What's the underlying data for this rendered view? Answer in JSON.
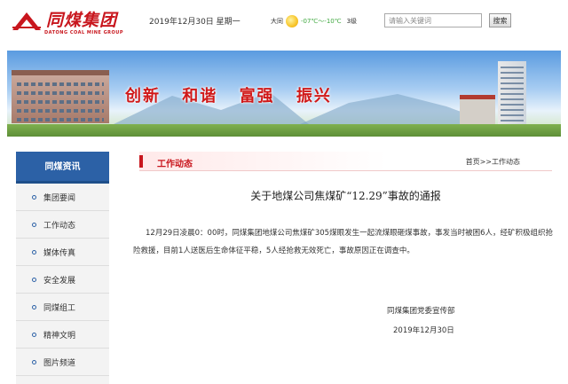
{
  "header": {
    "logo_title": "同煤集团",
    "logo_subtitle": "DATONG COAL MINE GROUP",
    "date": "2019年12月30日  星期一",
    "weather_city": "大同",
    "weather_icon": "sun-icon",
    "weather_temp": "-07℃～-10℃",
    "weather_wind": "3级",
    "search_placeholder": "请输入关键词",
    "search_button": "搜索"
  },
  "banner": {
    "slogan": [
      "创新",
      "和谐",
      "富强",
      "振兴"
    ]
  },
  "sidebar": {
    "title": "同煤资讯",
    "items": [
      {
        "label": "集团要闻"
      },
      {
        "label": "工作动态"
      },
      {
        "label": "媒体传真"
      },
      {
        "label": "安全发展"
      },
      {
        "label": "同煤组工"
      },
      {
        "label": "精神文明"
      },
      {
        "label": "图片频道"
      }
    ]
  },
  "content": {
    "section_title": "工作动态",
    "breadcrumb": "首页>>工作动态",
    "article_title": "关于地煤公司焦煤矿“12.29”事故的通报",
    "article_body": "12月29日凌晨0：00时，同煤集团地煤公司焦煤矿305煤眼发生一起流煤眼砸煤事故，事发当时被困6人，经矿积极组织抢险救援，目前1人送医后生命体征平稳，5人经抢救无效死亡，事故原因正在调查中。",
    "sign_org": "同煤集团党委宣传部",
    "sign_date": "2019年12月30日"
  },
  "colors": {
    "brand_red": "#c8161d",
    "nav_blue": "#2c61a6"
  }
}
